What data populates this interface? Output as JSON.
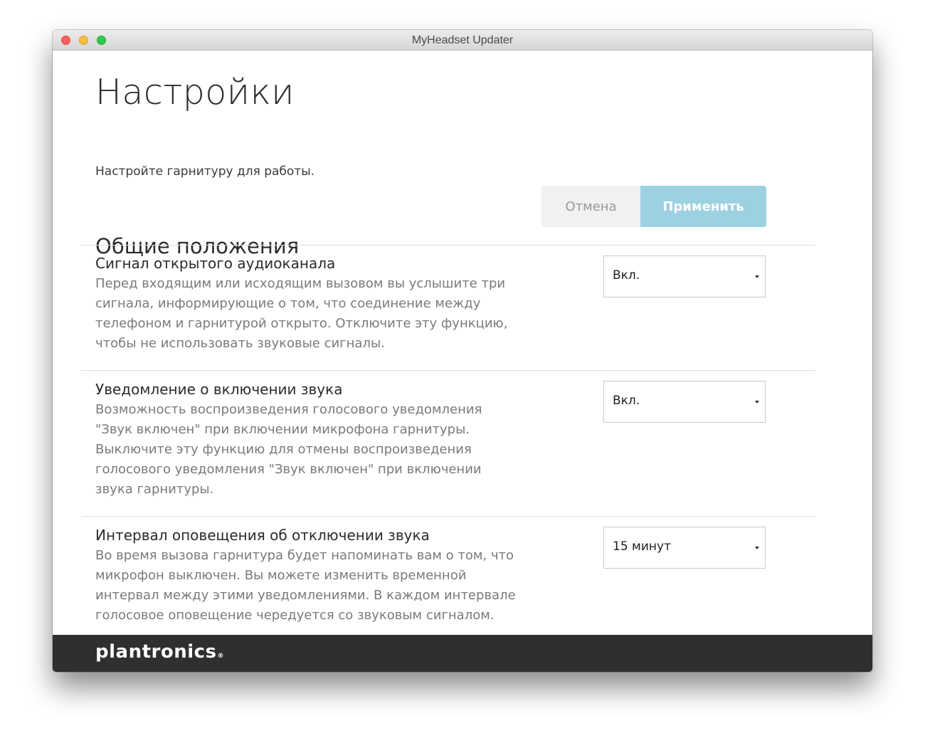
{
  "window": {
    "title": "MyHeadset Updater"
  },
  "page": {
    "title": "Настройки",
    "subtitle": "Настройте гарнитуру для работы."
  },
  "section": {
    "title": "Общие положения"
  },
  "actions": {
    "cancel_label": "Отмена",
    "apply_label": "Применить"
  },
  "settings": [
    {
      "name": "Сигнал открытого аудиоканала",
      "description": "Перед входящим или исходящим вызовом вы услышите три сигнала, информирующие о том, что соединение между телефоном и гарнитурой открыто. Отключите эту функцию, чтобы не использовать звуковые сигналы.",
      "value": "Вкл."
    },
    {
      "name": "Уведомление о включении звука",
      "description": "Возможность воспроизведения голосового уведомления \"Звук включен\" при включении микрофона гарнитуры. Выключите эту функцию для отмены воспроизведения голосового уведомления \"Звук включен\" при включении звука гарнитуры.",
      "value": "Вкл."
    },
    {
      "name": "Интервал оповещения об отключении звука",
      "description": "Во время вызова гарнитура будет напоминать вам о том, что микрофон выключен. Вы можете изменить временной интервал между этими уведомлениями. В каждом интервале голосовое оповещение чередуется со звуковым сигналом.",
      "value": "15 минут"
    }
  ],
  "footer": {
    "brand": "plantronics",
    "brand_mark": "®"
  },
  "colors": {
    "apply_button": "#9dd1e2",
    "cancel_button": "#f0f1f1",
    "footer": "#2f2f2f"
  }
}
